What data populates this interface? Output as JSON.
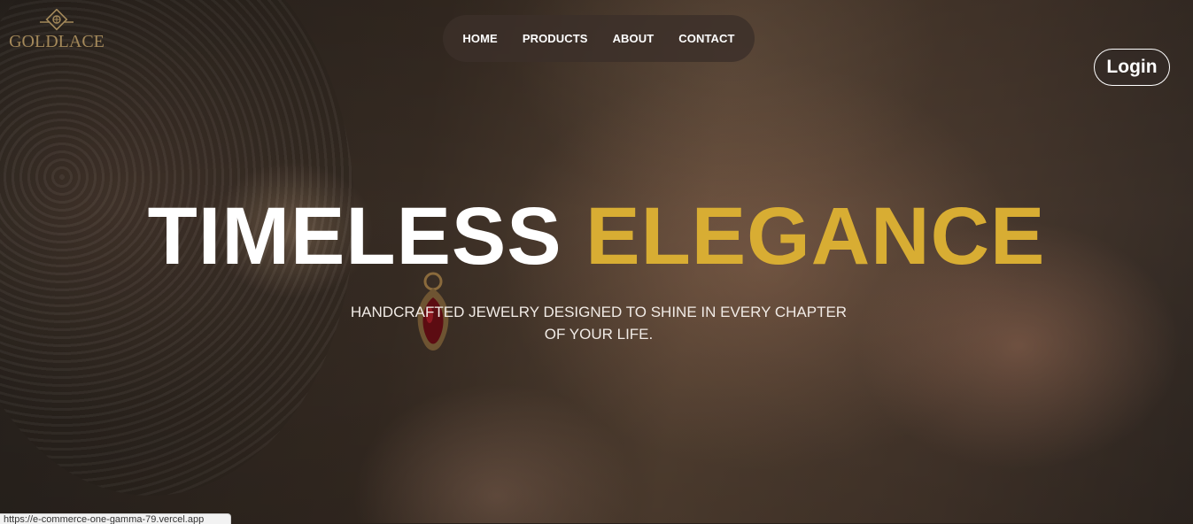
{
  "brand": {
    "name": "GOLDLACE",
    "logo_icon": "diamond-ornament-icon",
    "color": "#a4895a"
  },
  "nav": {
    "links": [
      "HOME",
      "PRODUCTS",
      "ABOUT",
      "CONTACT"
    ]
  },
  "header": {
    "login_label": "Login"
  },
  "hero": {
    "headline_white": "TIMELESS",
    "headline_gold": "ELEGANCE",
    "subtitle": "HANDCRAFTED JEWELRY DESIGNED TO SHINE IN EVERY CHAPTER OF YOUR LIFE.",
    "accent_color": "#d8ad33",
    "image_icon": "woman-with-earring-photo"
  },
  "status_bar": {
    "url": "https://e-commerce-one-gamma-79.vercel.app"
  }
}
